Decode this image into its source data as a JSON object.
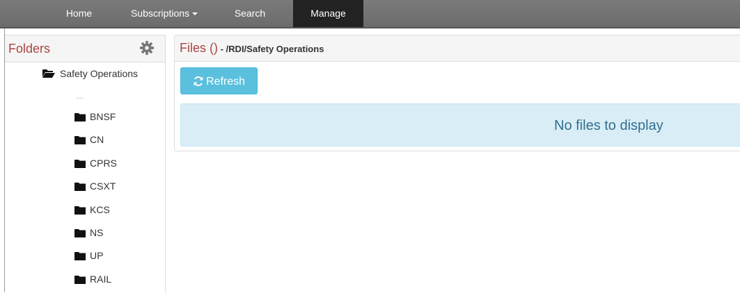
{
  "nav": {
    "items": [
      {
        "label": "Home"
      },
      {
        "label": "Subscriptions",
        "has_caret": true
      },
      {
        "label": "Search"
      },
      {
        "label": "Manage",
        "active": true
      }
    ]
  },
  "folders": {
    "title": "Folders",
    "settings_icon": "gear-icon",
    "root": {
      "label": "Safety Operations",
      "icon": "folder-open-icon"
    },
    "ellipsis": "...",
    "children": [
      {
        "label": "BNSF",
        "icon": "folder-icon"
      },
      {
        "label": "CN",
        "icon": "folder-icon"
      },
      {
        "label": "CPRS",
        "icon": "folder-icon"
      },
      {
        "label": "CSXT",
        "icon": "folder-icon"
      },
      {
        "label": "KCS",
        "icon": "folder-icon"
      },
      {
        "label": "NS",
        "icon": "folder-icon"
      },
      {
        "label": "UP",
        "icon": "folder-icon"
      },
      {
        "label": "RAIL",
        "icon": "folder-icon"
      }
    ]
  },
  "files": {
    "title": "Files ()",
    "path": " - /RDI/Safety Operations",
    "refresh_label": "Refresh",
    "empty_message": "No files to display"
  },
  "colors": {
    "navbar": "#6f6f6f",
    "nav_active": "#222222",
    "heading_red": "#a94442",
    "info_button": "#5bc0de",
    "alert_bg": "#d9edf7",
    "alert_text": "#31708f"
  }
}
